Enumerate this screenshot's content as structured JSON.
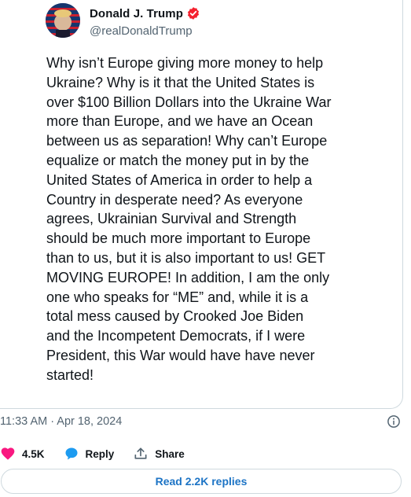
{
  "author": {
    "name": "Donald J. Trump",
    "handle": "@realDonaldTrump"
  },
  "tweet": {
    "text": "Why isn’t Europe giving more money to help\nUkraine? Why is it that the United States is\nover $100 Billion Dollars into the Ukraine War\nmore than Europe, and we have an Ocean\nbetween us as separation! Why can’t Europe\nequalize or match the money put in by the\nUnited States of America in order to help a\nCountry in desperate need? As everyone\nagrees, Ukrainian Survival and Strength\nshould be much more important to Europe\nthan to us, but it is also important to us! GET\nMOVING EUROPE! In addition, I am the only\none who speaks for “ME” and, while it is a\ntotal mess caused by Crooked Joe Biden\nand the Incompetent Democrats, if I were\nPresident, this War would have have never\nstarted!",
    "timestamp": "11:33 AM · Apr 18, 2024"
  },
  "actions": {
    "likes": "4.5K",
    "reply_label": "Reply",
    "share_label": "Share"
  },
  "replies_link": "Read 2.2K replies",
  "icons": [
    "verified-badge-icon",
    "info-icon",
    "heart-icon",
    "reply-bubble-icon",
    "share-icon"
  ],
  "colors": {
    "like": "#f91880",
    "reply": "#1d9bf0",
    "verified": "#f4212e",
    "link": "#1d74c5",
    "muted": "#536471"
  }
}
